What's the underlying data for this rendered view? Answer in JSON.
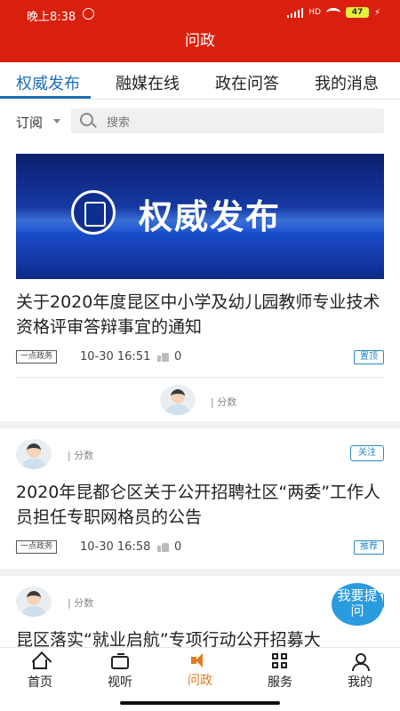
{
  "status_bar": {
    "time": "晚上8:38",
    "network": "HD",
    "battery": "47"
  },
  "header": {
    "title": "问政"
  },
  "tabs": [
    {
      "label": "权威发布",
      "active": true
    },
    {
      "label": "融媒在线",
      "active": false
    },
    {
      "label": "政在问答",
      "active": false
    },
    {
      "label": "我的消息",
      "active": false
    }
  ],
  "filter": {
    "subscribe_label": "订阅",
    "search_placeholder": "搜索"
  },
  "posts": [
    {
      "banner_text": "权威发布",
      "title": "关于2020年度昆区中小学及幼儿园教师专业技术资格评审答辩事宜的通知",
      "source": "一点政务",
      "time": "10-30 16:51",
      "likes": "0",
      "badge": "置顶",
      "author_score_label": "| 分数"
    },
    {
      "author_score_label": "| 分数",
      "follow_label": "关注",
      "title": "2020年昆都仑区关于公开招聘社区“两委”工作人员担任专职网格员的公告",
      "source": "一点政务",
      "time": "10-30 16:58",
      "likes": "0",
      "badge": "推荐"
    },
    {
      "author_score_label": "| 分数",
      "follow_label": "关注",
      "title": "昆区落实“就业启航”专项行动公开招募大"
    }
  ],
  "fab": {
    "label": "我要提问"
  },
  "bottom_nav": [
    {
      "label": "首页",
      "icon": "home-icon"
    },
    {
      "label": "视听",
      "icon": "tv-icon"
    },
    {
      "label": "问政",
      "icon": "speaker-icon",
      "active": true
    },
    {
      "label": "服务",
      "icon": "grid-icon"
    },
    {
      "label": "我的",
      "icon": "user-icon"
    }
  ],
  "colors": {
    "brand_red": "#d9200e",
    "tab_blue": "#1d6fb8",
    "badge_blue": "#2a87c8",
    "nav_active": "#e07b22",
    "fab_blue": "#2b9be0"
  }
}
